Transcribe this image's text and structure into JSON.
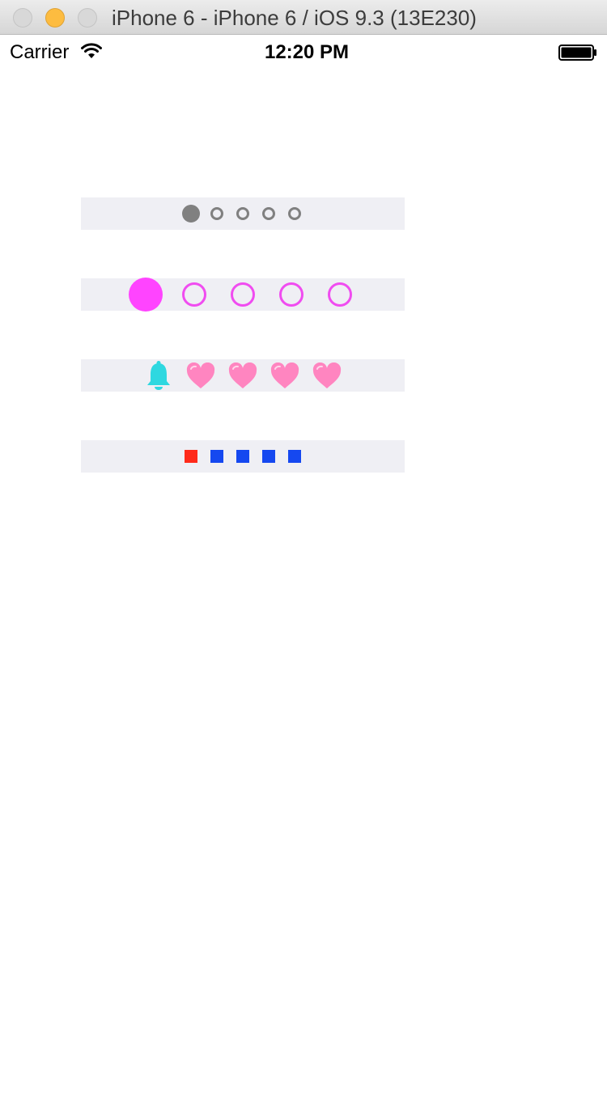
{
  "window": {
    "title": "iPhone 6 - iPhone 6 / iOS 9.3 (13E230)"
  },
  "status_bar": {
    "carrier": "Carrier",
    "time": "12:20 PM",
    "icons": [
      "wifi-icon",
      "battery-icon"
    ]
  },
  "page_controls": [
    {
      "style": "gray-dots",
      "page_count": 5,
      "current_page": 1,
      "colors": {
        "active": "#808080",
        "inactive": "#808080"
      }
    },
    {
      "style": "magenta-circles",
      "page_count": 5,
      "current_page": 1,
      "colors": {
        "active": "#ff44ff",
        "inactive": "#f04cf0"
      }
    },
    {
      "style": "bell-and-hearts",
      "page_count": 5,
      "current_page": 1,
      "icons": {
        "active": "bell-icon",
        "inactive": "heart-icon"
      },
      "colors": {
        "active": "#2ed8e0",
        "inactive": "#ff85c0"
      }
    },
    {
      "style": "squares",
      "page_count": 5,
      "current_page": 1,
      "colors": {
        "active": "#ff2a1a",
        "inactive": "#1548f0"
      }
    }
  ],
  "colors": {
    "row_background": "#efeff4",
    "titlebar": "#e3e3e3",
    "minimize_button": "#fdbc40"
  }
}
